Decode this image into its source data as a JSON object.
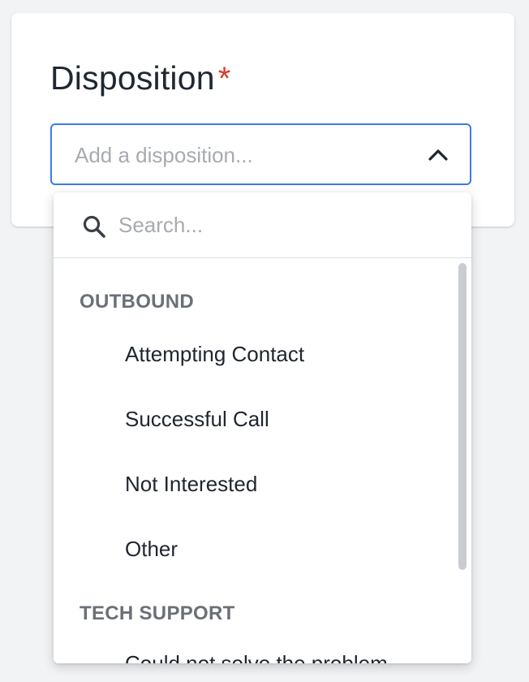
{
  "field": {
    "label": "Disposition",
    "required_mark": "*",
    "placeholder": "Add a disposition..."
  },
  "dropdown": {
    "search_placeholder": "Search...",
    "groups": [
      {
        "header": "OUTBOUND",
        "options": [
          "Attempting Contact",
          "Successful Call",
          "Not Interested",
          "Other"
        ]
      },
      {
        "header": "TECH SUPPORT",
        "options": [
          "Could not solve the problem"
        ]
      }
    ]
  },
  "icons": {
    "chevron": "chevron-up-icon",
    "search": "search-icon"
  },
  "colors": {
    "accent": "#3b7be4",
    "required": "#d93b2b",
    "group_header": "#6b7077",
    "placeholder": "#a7abb1"
  }
}
